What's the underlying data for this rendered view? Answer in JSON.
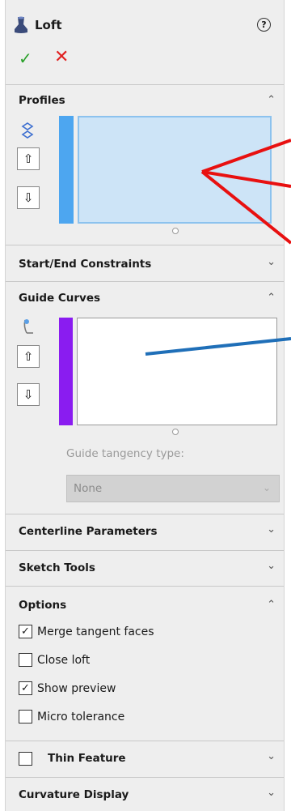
{
  "header": {
    "title": "Loft",
    "help_glyph": "?",
    "ok_glyph": "✓",
    "cancel_glyph": "✕"
  },
  "sections": {
    "profiles": {
      "title": "Profiles",
      "chevron": "⌃",
      "up_glyph": "⇧",
      "down_glyph": "⇩"
    },
    "start_end": {
      "title": "Start/End Constraints",
      "chevron": "⌄"
    },
    "guide_curves": {
      "title": "Guide Curves",
      "chevron": "⌃",
      "up_glyph": "⇧",
      "down_glyph": "⇩",
      "tangency_label": "Guide tangency type:",
      "tangency_value": "None",
      "combo_chevron": "⌄"
    },
    "centerline": {
      "title": "Centerline Parameters",
      "chevron": "⌄"
    },
    "sketch_tools": {
      "title": "Sketch Tools",
      "chevron": "⌄"
    },
    "options": {
      "title": "Options",
      "chevron": "⌃",
      "items": [
        {
          "label": "Merge tangent faces",
          "checked": true,
          "mark": "✓"
        },
        {
          "label": "Close loft",
          "checked": false,
          "mark": ""
        },
        {
          "label": "Show preview",
          "checked": true,
          "mark": "✓"
        },
        {
          "label": "Micro tolerance",
          "checked": false,
          "mark": ""
        }
      ]
    },
    "thin_feature": {
      "title": "Thin Feature",
      "chevron": "⌄",
      "checked": false
    },
    "curvature": {
      "title": "Curvature Display",
      "chevron": "⌄"
    }
  },
  "colors": {
    "profiles_bar": "#4da6f0",
    "profiles_fill": "#cde4f7",
    "guide_bar": "#8a1cf0",
    "annotation_red": "#e81010",
    "annotation_blue": "#1f6fb8",
    "ok": "#2aa02a",
    "cancel": "#e02020"
  }
}
